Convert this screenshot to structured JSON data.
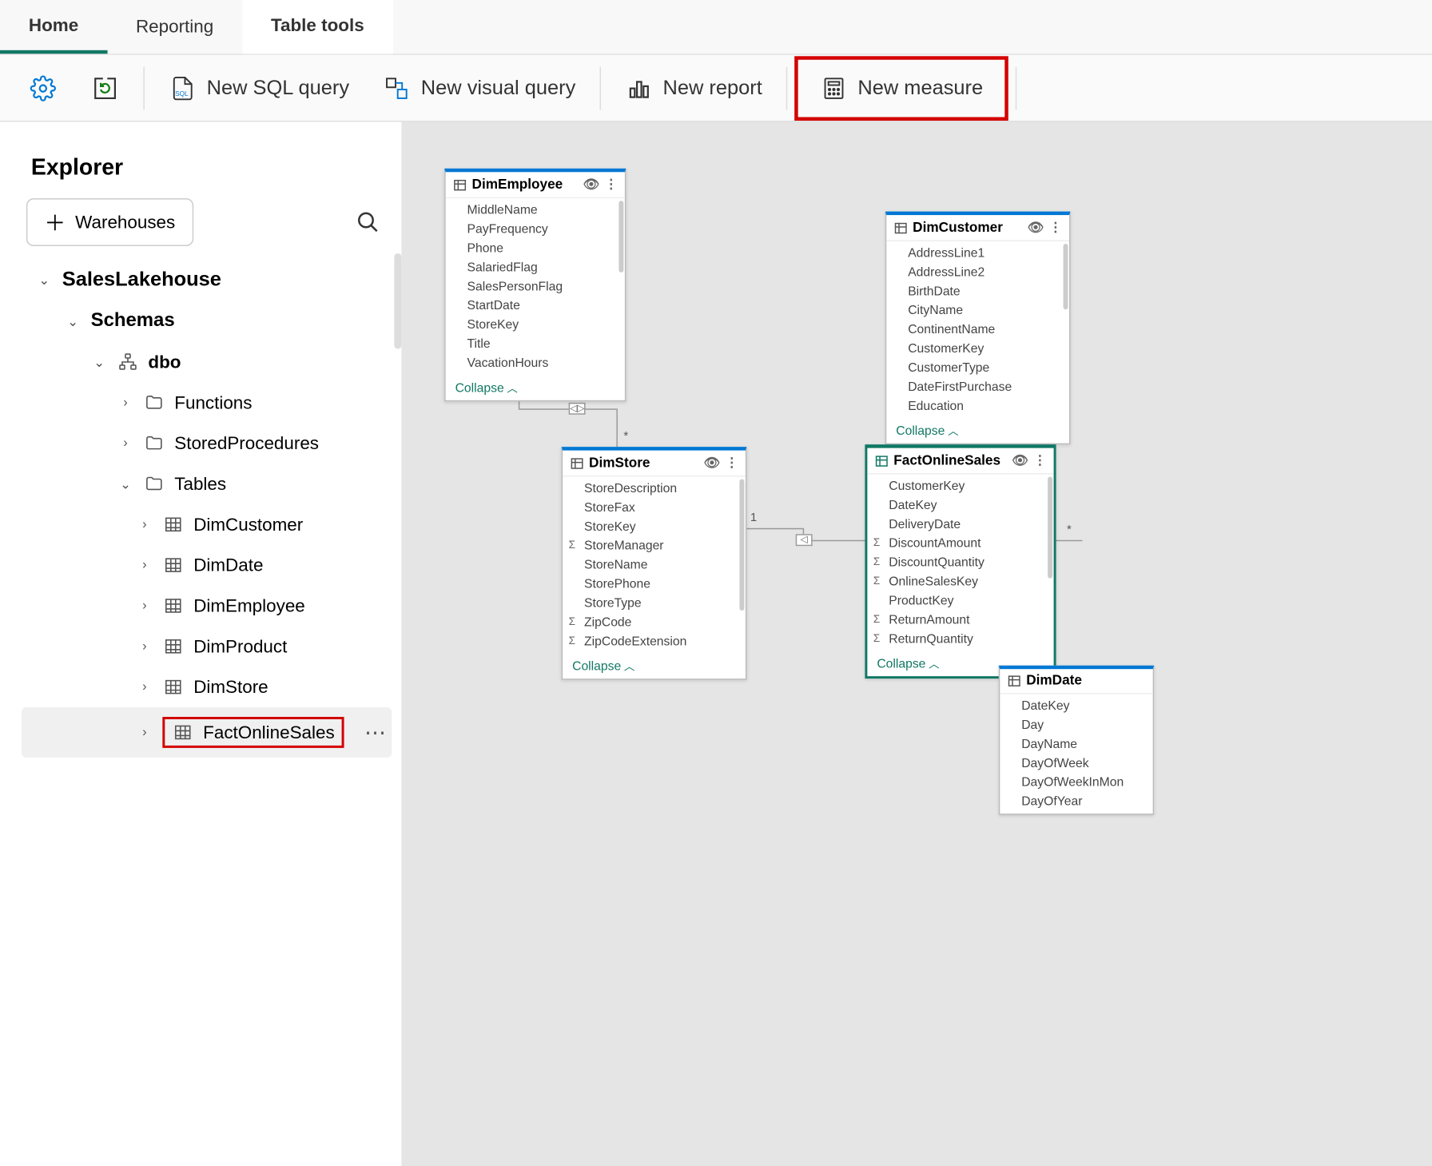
{
  "tabs": {
    "home": "Home",
    "reporting": "Reporting",
    "tools": "Table tools"
  },
  "ribbon": {
    "new_sql": "New SQL query",
    "new_visual": "New visual query",
    "new_report": "New report",
    "new_measure": "New measure"
  },
  "explorer": {
    "title": "Explorer",
    "warehouses": "Warehouses",
    "root": "SalesLakehouse",
    "schemas": "Schemas",
    "dbo": "dbo",
    "functions": "Functions",
    "sprocs": "StoredProcedures",
    "tables": "Tables",
    "tbl": {
      "cust": "DimCustomer",
      "date": "DimDate",
      "emp": "DimEmployee",
      "prod": "DimProduct",
      "store": "DimStore",
      "fact": "FactOnlineSales"
    }
  },
  "entities": {
    "dimEmployee": {
      "name": "DimEmployee",
      "collapse": "Collapse",
      "cols": [
        "MiddleName",
        "PayFrequency",
        "Phone",
        "SalariedFlag",
        "SalesPersonFlag",
        "StartDate",
        "StoreKey",
        "Title",
        "VacationHours"
      ]
    },
    "dimCustomer": {
      "name": "DimCustomer",
      "collapse": "Collapse",
      "cols": [
        "AddressLine1",
        "AddressLine2",
        "BirthDate",
        "CityName",
        "ContinentName",
        "CustomerKey",
        "CustomerType",
        "DateFirstPurchase",
        "Education"
      ]
    },
    "dimStore": {
      "name": "DimStore",
      "collapse": "Collapse",
      "cols": [
        {
          "n": "StoreDescription"
        },
        {
          "n": "StoreFax"
        },
        {
          "n": "StoreKey"
        },
        {
          "n": "StoreManager",
          "s": true
        },
        {
          "n": "StoreName"
        },
        {
          "n": "StorePhone"
        },
        {
          "n": "StoreType"
        },
        {
          "n": "ZipCode",
          "s": true
        },
        {
          "n": "ZipCodeExtension",
          "s": true
        }
      ]
    },
    "factOnlineSales": {
      "name": "FactOnlineSales",
      "collapse": "Collapse",
      "cols": [
        {
          "n": "CustomerKey"
        },
        {
          "n": "DateKey"
        },
        {
          "n": "DeliveryDate"
        },
        {
          "n": "DiscountAmount",
          "s": true
        },
        {
          "n": "DiscountQuantity",
          "s": true
        },
        {
          "n": "OnlineSalesKey",
          "s": true
        },
        {
          "n": "ProductKey"
        },
        {
          "n": "ReturnAmount",
          "s": true
        },
        {
          "n": "ReturnQuantity",
          "s": true
        }
      ]
    },
    "dimDate": {
      "name": "DimDate",
      "cols": [
        "DateKey",
        "Day",
        "DayName",
        "DayOfWeek",
        "DayOfWeekInMon",
        "DayOfYear"
      ]
    }
  },
  "rel": {
    "one": "1",
    "many": "*"
  }
}
